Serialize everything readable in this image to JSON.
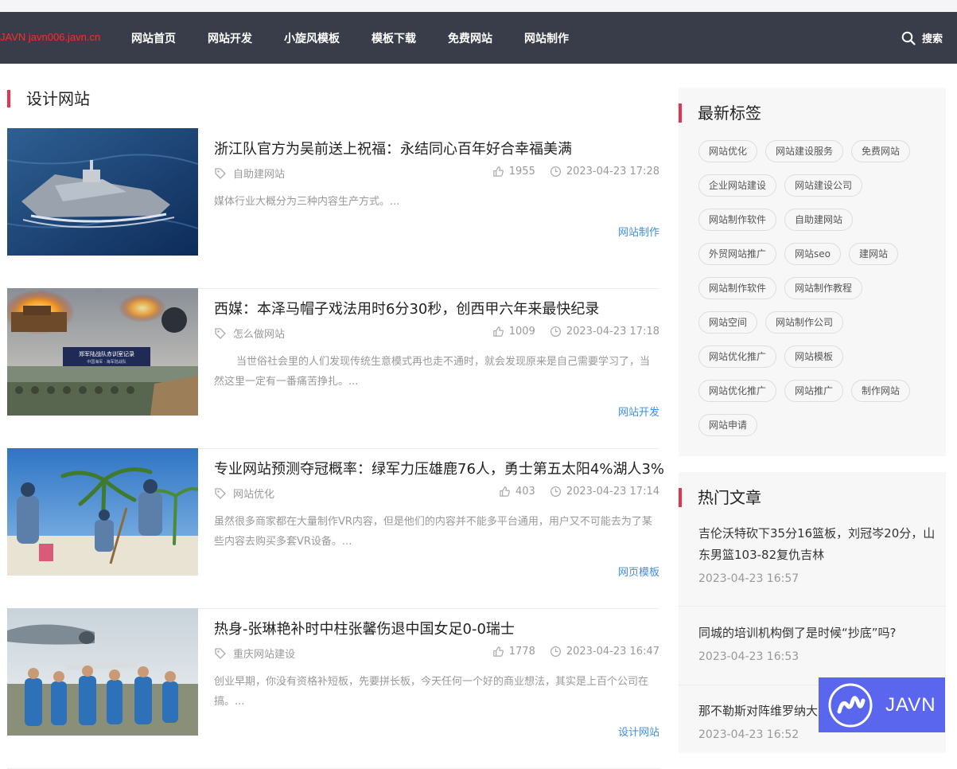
{
  "header": {
    "logo": "JAVN javn006.javn.cn",
    "nav": [
      "网站首页",
      "网站开发",
      "小旋风模板",
      "模板下载",
      "免费网站",
      "网站制作"
    ],
    "search_label": "搜索"
  },
  "main": {
    "section_title": "设计网站",
    "articles": [
      {
        "title": "浙江队官方为吴前送上祝福：永结同心百年好合幸福美满",
        "tag": "自助建网站",
        "likes": "1955",
        "time": "2023-04-23 17:28",
        "excerpt": "媒体行业大概分为三种内容生产方式。...",
        "category": "网站制作"
      },
      {
        "title": "西媒：本泽马帽子戏法用时6分30秒，创西甲六年来最快纪录",
        "tag": "怎么做网站",
        "likes": "1009",
        "time": "2023-04-23 17:18",
        "excerpt": "当世俗社会里的人们发现传统生意模式再也走不通时，就会发现原来是自己需要学习了，当然这里一定有一番痛苦挣扎。...",
        "category": "网站开发"
      },
      {
        "title": "专业网站预测夺冠概率：绿军力压雄鹿76人，勇士第五太阳4%湖人3%",
        "tag": "网站优化",
        "likes": "403",
        "time": "2023-04-23 17:14",
        "excerpt": "虽然很多商家都在大量制作VR内容，但是他们的内容并不能多平台通用，用户又不可能去为了某些内容去购买多套VR设备。...",
        "category": "网页模板"
      },
      {
        "title": "热身-张琳艳补时中柱张馨伤退中国女足0-0瑞士",
        "tag": "重庆网站建设",
        "likes": "1778",
        "time": "2023-04-23 16:47",
        "excerpt": "创业早期，你没有资格补短板，先要拼长板，今天任何一个好的商业想法，其实是上百个公司在搞。...",
        "category": "设计网站"
      }
    ],
    "image_captions": [
      "郑军陆战队赤训室记录",
      "中国海军 · 海军陆战队"
    ]
  },
  "sidebar": {
    "tags_title": "最新标签",
    "tags": [
      "网站优化",
      "网站建设服务",
      "免费网站",
      "企业网站建设",
      "网站建设公司",
      "网站制作软件",
      "自助建网站",
      "外贸网站推广",
      "网站seo",
      "建网站",
      "网站制作软件",
      "网站制作教程",
      "网站空间",
      "网站制作公司",
      "网站优化推广",
      "网站模板",
      "网站优化推广",
      "网站推广",
      "制作网站",
      "网站申请"
    ],
    "hot_title": "热门文章",
    "hot": [
      {
        "title": "吉伦沃特砍下35分16篮板，刘冠岑20分，山东男篮103-82复仇吉林",
        "date": "2023-04-23 16:57"
      },
      {
        "title": "同城的培训机构倒了是时候“抄底”吗?",
        "date": "2023-04-23 16:53"
      },
      {
        "title": "那不勒斯对阵维罗纳大名单：奥斯梅恩回归",
        "date": "2023-04-23 16:52"
      }
    ]
  },
  "float_logo": {
    "text": "JAVN"
  },
  "colors": {
    "nav_bg": "#393d49",
    "accent": "#e9334e",
    "link": "#3f8ede",
    "logo": "#ff2a2a",
    "float_bg": "#5b66ee"
  },
  "icons": [
    "search-icon",
    "tag-icon",
    "thumbs-up-icon",
    "clock-icon",
    "javn-logo-icon"
  ]
}
